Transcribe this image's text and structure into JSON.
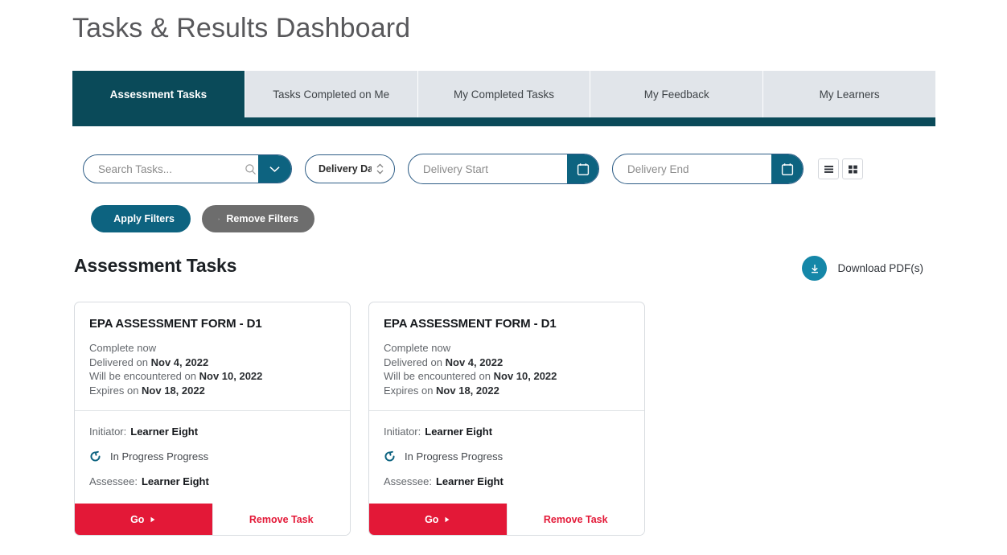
{
  "header": {
    "title": "Tasks & Results Dashboard"
  },
  "tabs": [
    {
      "label": "Assessment Tasks",
      "active": true
    },
    {
      "label": "Tasks Completed on Me",
      "active": false
    },
    {
      "label": "My Completed Tasks",
      "active": false
    },
    {
      "label": "My Feedback",
      "active": false
    },
    {
      "label": "My Learners",
      "active": false
    }
  ],
  "filters": {
    "search": {
      "value": "",
      "placeholder": "Search Tasks...",
      "icon": "search-icon",
      "dropdown_icon": "chevron-down-icon"
    },
    "sort_select": {
      "value": "Delivery Date",
      "icon": "chevron-updown-icon"
    },
    "delivery_start": {
      "value": "",
      "placeholder": "Delivery Start",
      "icon": "calendar-icon"
    },
    "delivery_end": {
      "value": "",
      "placeholder": "Delivery End",
      "icon": "calendar-icon"
    },
    "view_toggle": [
      {
        "name": "list-view",
        "icon": "list-view-icon",
        "active": false
      },
      {
        "name": "grid-view",
        "icon": "grid-view-icon",
        "active": false
      }
    ],
    "apply_label": "Apply Filters",
    "apply_icon": "plus-icon",
    "remove_label": "Remove Filters",
    "remove_icon": "close-icon"
  },
  "section": {
    "title": "Assessment Tasks",
    "download_label": "Download PDF(s)",
    "download_icon": "download-icon"
  },
  "cards": [
    {
      "title": "EPA ASSESSMENT FORM - D1",
      "complete_text": "Complete now",
      "delivered_label": "Delivered on",
      "delivered_date": "Nov 4, 2022",
      "encounter_label": "Will be encountered on",
      "encounter_date": "Nov 10, 2022",
      "expires_label": "Expires on",
      "expires_date": "Nov 18, 2022",
      "initiator_label": "Initiator:",
      "initiator_name": "Learner Eight",
      "status_icon": "progress-spinner-icon",
      "status_text": "In Progress  Progress",
      "assessee_label": "Assessee:",
      "assessee_name": "Learner Eight",
      "go_label": "Go",
      "go_icon": "arrow-right-icon",
      "remove_label": "Remove Task"
    },
    {
      "title": "EPA ASSESSMENT FORM - D1",
      "complete_text": "Complete now",
      "delivered_label": "Delivered on",
      "delivered_date": "Nov 4, 2022",
      "encounter_label": "Will be encountered on",
      "encounter_date": "Nov 10, 2022",
      "expires_label": "Expires on",
      "expires_date": "Nov 18, 2022",
      "initiator_label": "Initiator:",
      "initiator_name": "Learner Eight",
      "status_icon": "progress-spinner-icon",
      "status_text": "In Progress  Progress",
      "assessee_label": "Assessee:",
      "assessee_name": "Learner Eight",
      "go_label": "Go",
      "go_icon": "arrow-right-icon",
      "remove_label": "Remove Task"
    }
  ],
  "colors": {
    "teal_dark": "#0a4a59",
    "teal": "#0d6380",
    "teal_light": "#1587a8",
    "red": "#e31837",
    "gray_button": "#6d6d6d",
    "tab_inactive": "#e1e5ea"
  }
}
